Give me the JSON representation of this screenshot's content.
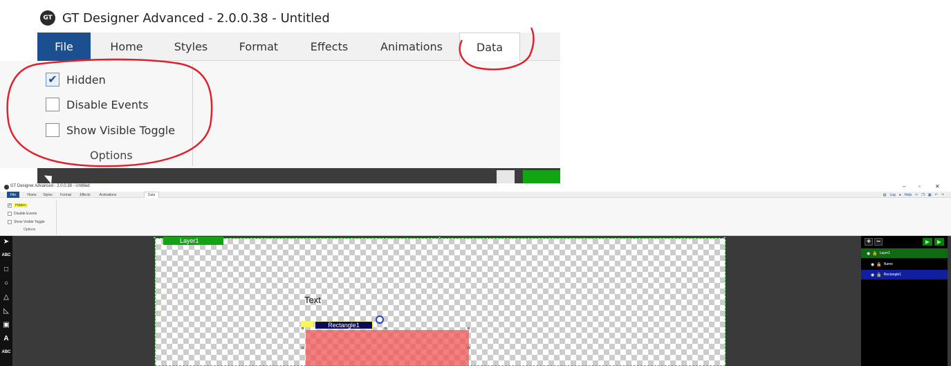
{
  "zoom": {
    "app_title": "GT Designer Advanced - 2.0.0.38 - Untitled",
    "logo_text": "GT",
    "tabs": [
      "File",
      "Home",
      "Styles",
      "Format",
      "Effects",
      "Animations",
      "Data"
    ],
    "options": [
      {
        "label": "Hidden",
        "checked": true
      },
      {
        "label": "Disable Events",
        "checked": false
      },
      {
        "label": "Show Visible Toggle",
        "checked": false
      }
    ],
    "group_label": "Options",
    "annotation_color": "#e0202a"
  },
  "full": {
    "app_title": "GT Designer Advanced - 2.0.0.38 - Untitled",
    "tabs": [
      "File",
      "Home",
      "Styles",
      "Format",
      "Effects",
      "Animations",
      "Data"
    ],
    "options": [
      {
        "label": "Hidden",
        "checked": true
      },
      {
        "label": "Disable Events",
        "checked": false
      },
      {
        "label": "Show Visible Toggle",
        "checked": false
      }
    ],
    "group_label": "Options",
    "right_tools": {
      "log": "Log",
      "help": "Help"
    },
    "toolbar_icons": [
      "pointer-icon",
      "text-icon",
      "rectangle-icon",
      "circle-icon",
      "triangle-icon",
      "right-triangle-icon",
      "image-icon",
      "font-icon",
      "label-icon"
    ],
    "tool_glyphs": [
      "➤",
      "ABC",
      "□",
      "○",
      "△",
      "◺",
      "▣",
      "A",
      "ABC"
    ],
    "canvas": {
      "layer_label": "Layer1",
      "text_label": "Text",
      "rect_label": "Rectangle1"
    },
    "layers": [
      {
        "name": "Layer1",
        "selected": false,
        "is_layer": true
      },
      {
        "name": "Name",
        "selected": false,
        "is_layer": false
      },
      {
        "name": "Rectangle1",
        "selected": true,
        "is_layer": false
      }
    ],
    "colors": {
      "file_tab": "#1c4f8f",
      "layer_green": "#14a214",
      "layer_row_green": "#0f6b0f",
      "selected_row_blue": "#0f1f9e",
      "highlight_yellow": "#f7f75a",
      "rect_fill": "#f05a5a"
    }
  }
}
